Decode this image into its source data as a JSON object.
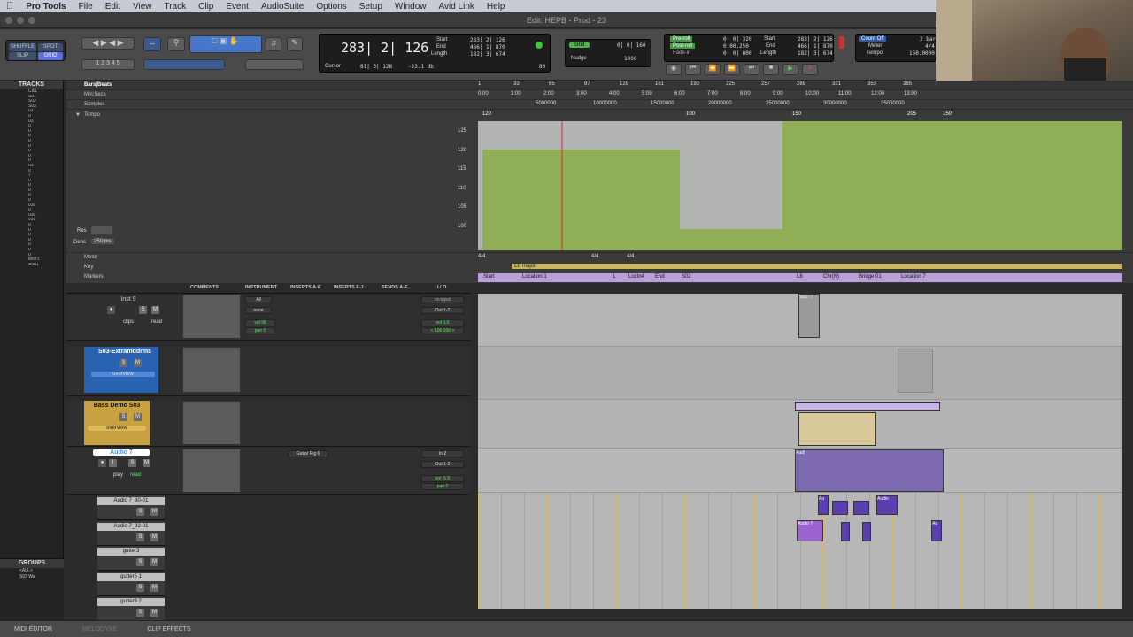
{
  "menubar": {
    "app": "Pro Tools",
    "items": [
      "File",
      "Edit",
      "View",
      "Track",
      "Clip",
      "Event",
      "AudioSuite",
      "Options",
      "Setup",
      "Window",
      "Avid Link",
      "Help"
    ]
  },
  "window": {
    "title": "Edit: HEPB - Prod - 23"
  },
  "edit_modes": {
    "shuffle": "SHUFFLE",
    "spot": "SPOT",
    "slip": "SLIP",
    "grid": "GRID"
  },
  "counter": {
    "main": "283| 2| 126",
    "cursor_label": "Cursor",
    "cursor_value": "81| 3| 128",
    "cursor_db": "-23.1 db",
    "start_label": "Start",
    "start": "283| 2| 126",
    "end_label": "End",
    "end": "466| 1| 870",
    "length_label": "Length",
    "length": "182| 3| 674",
    "count": "80"
  },
  "grid": {
    "grid_label": "Grid",
    "grid_value": "0| 0| 160",
    "nudge_label": "Nudge",
    "nudge_value": "1000"
  },
  "transport": {
    "preroll": "Pre-roll",
    "preroll_val": "0| 0| 320",
    "postroll": "Post-roll",
    "postroll_val": "0:00.250",
    "fadein": "Fade-in",
    "fadein_val": "0| 0| 800",
    "start_label": "Start",
    "start": "283| 2| 126",
    "end_label": "End",
    "end": "466| 1| 870",
    "length_label": "Length",
    "length": "182| 3| 674"
  },
  "countoff": {
    "label": "Count Off",
    "value": "2 bars",
    "meter_label": "Meter",
    "meter": "4/4",
    "tempo_label": "Tempo",
    "tempo": "150.0000"
  },
  "tracks_panel": {
    "header": "TRACKS",
    "items": [
      "Clc1",
      "S01",
      "S02",
      "S03",
      "03",
      "0",
      "03",
      "0",
      "0",
      "0",
      "0",
      "0",
      "0",
      "0",
      "0",
      "03",
      "0",
      "7",
      "0",
      "0",
      "0",
      "0",
      "0",
      "030",
      "0",
      "030",
      "030",
      "0",
      "0",
      "0",
      "0",
      "0",
      "0",
      "0",
      "Mstr1",
      "Aud1"
    ]
  },
  "groups_panel": {
    "header": "GROUPS",
    "items": [
      "<ALL>",
      "S03 Wa"
    ]
  },
  "rulers": {
    "bars_label": "Bars|Beats",
    "minsecs_label": "Min:Secs",
    "samples_label": "Samples",
    "tempo_label": "Tempo",
    "bars_ticks": [
      "1",
      "33",
      "65",
      "97",
      "129",
      "161",
      "193",
      "225",
      "257",
      "289",
      "321",
      "353",
      "385"
    ],
    "min_ticks": [
      "0:00",
      "1:00",
      "2:00",
      "3:00",
      "4:00",
      "5:00",
      "6:00",
      "7:00",
      "8:00",
      "9:00",
      "10:00",
      "11:00",
      "12:00",
      "13:00"
    ],
    "sample_ticks": [
      "5000000",
      "10000000",
      "15000000",
      "20000000",
      "25000000",
      "30000000",
      "35000000"
    ],
    "tempo_scale": [
      "125",
      "120",
      "115",
      "110",
      "105",
      "100"
    ],
    "tempo_markers": [
      "120",
      "100",
      "150",
      "205",
      "150"
    ]
  },
  "tempo_display": {
    "res_label": "Res",
    "res_value": "",
    "dens_label": "Dens",
    "dens_value": "250 ms"
  },
  "meter_ruler": {
    "meter_label": "Meter",
    "key_label": "Key",
    "markers_label": "Markers",
    "meters": [
      "4/4",
      "4/4",
      "4/4"
    ],
    "key": "Eb major",
    "markers": [
      "Start",
      "Location 1",
      "1",
      "Loctn4",
      "End",
      "S02",
      "L8",
      "Chr(N)",
      "Bridge 01",
      "Location 7"
    ]
  },
  "columns": {
    "comments": "COMMENTS",
    "instrument": "INSTRUMENT",
    "inserts_ae": "INSERTS A-E",
    "inserts_fj": "INSERTS F-J",
    "sends_ae": "SENDS A-E",
    "io": "I / O"
  },
  "tracks": [
    {
      "name": "Inst 9",
      "io_in": "no input",
      "io_out": "Out 1-2",
      "vol": "vol  0.0",
      "pan": "< 100  100 >",
      "instr": "All",
      "instr2": "none",
      "ivol": "vol  96",
      "ipan": "pan  0",
      "btn1": "clips",
      "btn2": "read"
    },
    {
      "name": "S03-Extramddrms",
      "view": "overview"
    },
    {
      "name": "Bass Demo S03",
      "view": "overview"
    },
    {
      "name": "Audio 7",
      "insert": "Guitar Rig 6",
      "io_in": "In 2",
      "io_out": "Out 1-2",
      "vol": "vol  -5.5",
      "pan": "pan  0",
      "mode": "play",
      "auto": "read"
    }
  ],
  "subtracks": [
    "Audio 7_30-01",
    "Audio 7_32-01",
    "gutter3",
    "gutter5 1",
    "gutter9 2"
  ],
  "clips": {
    "s02": "S02 - I",
    "audio_a": "Audi",
    "audio_b": "Auc",
    "audio_c": "Au",
    "audio_d": "Audio",
    "audio7": "Audio 7"
  },
  "bottom": [
    "MIDI EDITOR",
    "MELODYNE",
    "CLIP EFFECTS"
  ]
}
